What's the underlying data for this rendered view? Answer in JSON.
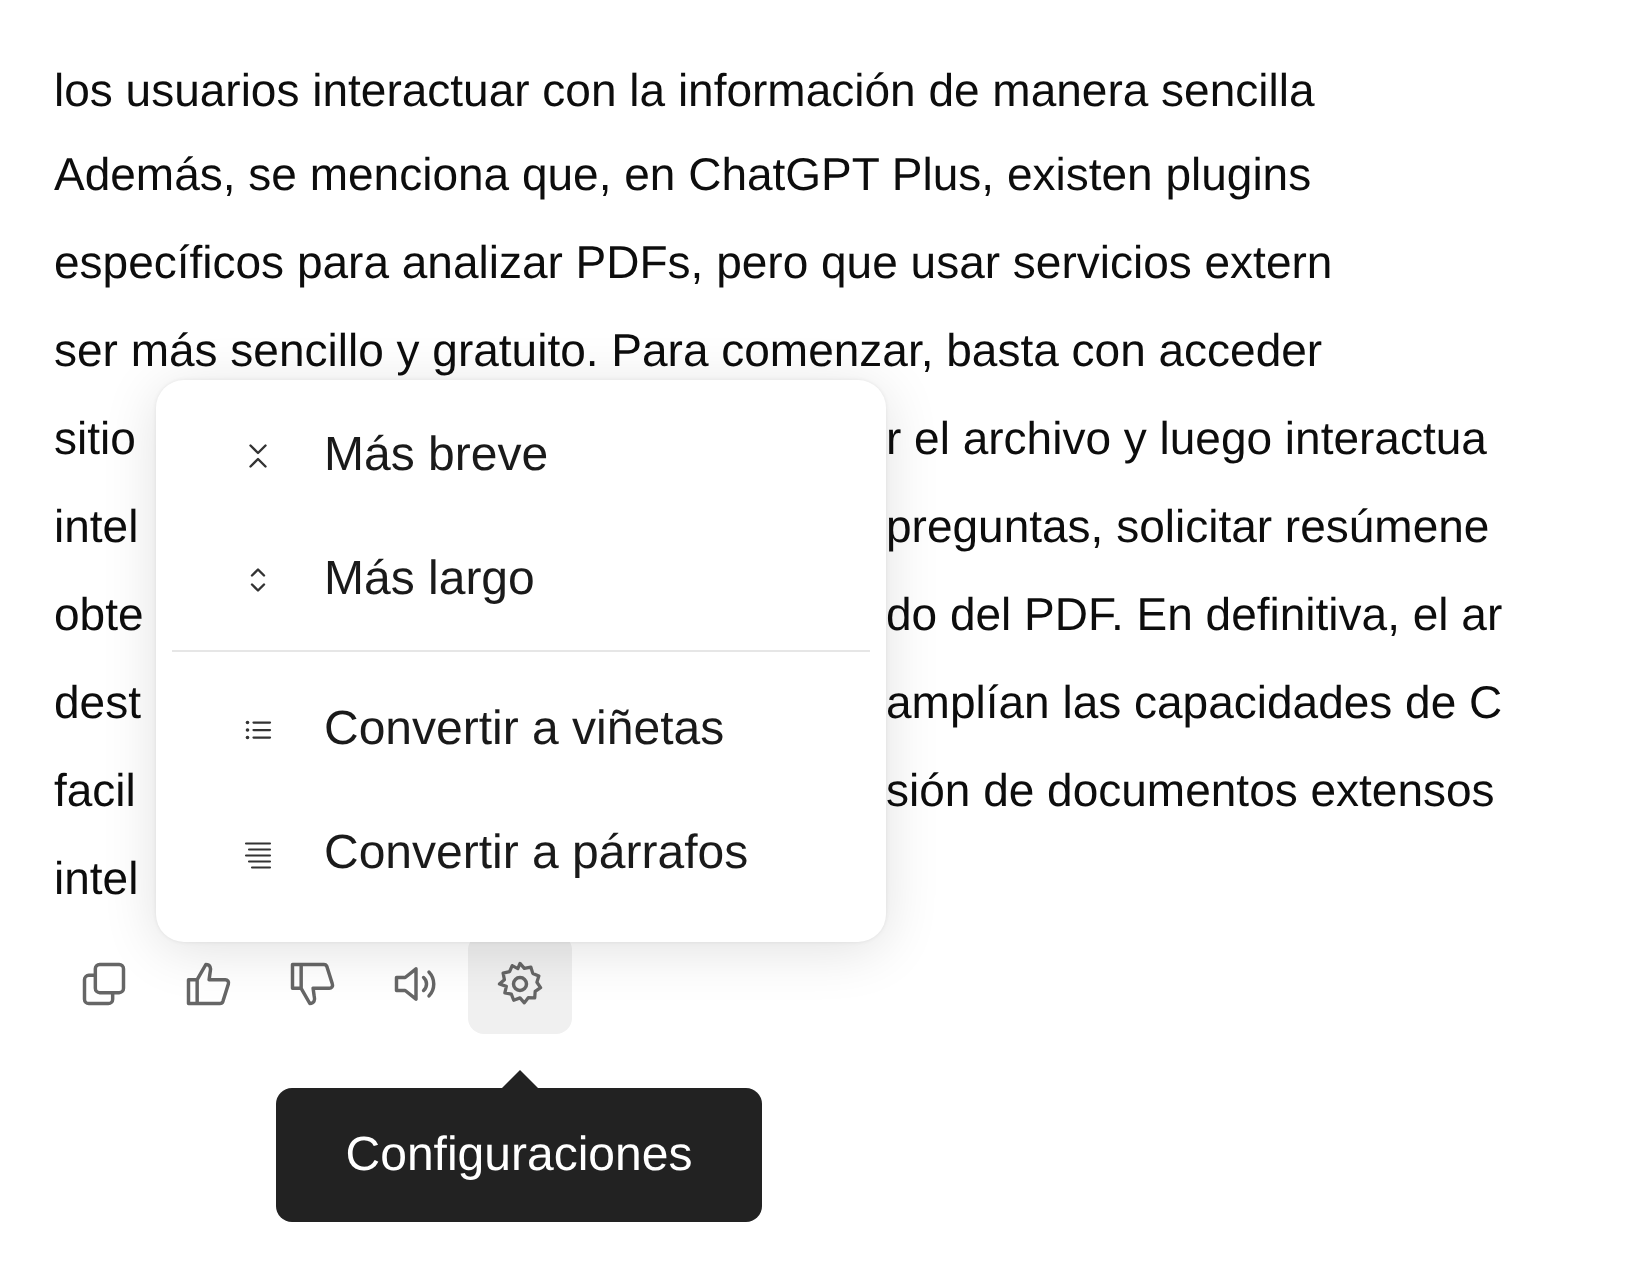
{
  "paragraphs": [
    {
      "lines": [
        {
          "text": "los usuarios interactuar con la información de manera sencilla"
        }
      ]
    },
    {
      "lines": [
        {
          "text": "Además, se menciona que, en ChatGPT Plus, existen plugins"
        },
        {
          "text": "específicos para analizar PDFs, pero que usar servicios extern"
        },
        {
          "text": "ser más sencillo y gratuito. Para comenzar, basta con acceder"
        },
        {
          "left": "sitio",
          "right": "r el archivo y luego interactua"
        },
        {
          "left": "intel",
          "right": "preguntas, solicitar resúmene"
        },
        {
          "left": "obte",
          "right": "do del PDF. En definitiva, el ar"
        },
        {
          "left": "dest",
          "right": "amplían las capacidades de C"
        },
        {
          "left": "facil",
          "right": "sión de documentos extensos"
        },
        {
          "left": "intel"
        }
      ]
    }
  ],
  "menu": {
    "groups": [
      [
        {
          "kind": "shorter",
          "label": "Más breve"
        },
        {
          "kind": "longer",
          "label": "Más largo"
        }
      ],
      [
        {
          "kind": "bullets",
          "label": "Convertir a viñetas"
        },
        {
          "kind": "paragraphs",
          "label": "Convertir a párrafos"
        }
      ]
    ]
  },
  "actions": [
    {
      "kind": "copy",
      "hovered": false
    },
    {
      "kind": "like",
      "hovered": false
    },
    {
      "kind": "dislike",
      "hovered": false
    },
    {
      "kind": "speaker",
      "hovered": false
    },
    {
      "kind": "settings",
      "hovered": true
    }
  ],
  "tooltip": "Configuraciones"
}
